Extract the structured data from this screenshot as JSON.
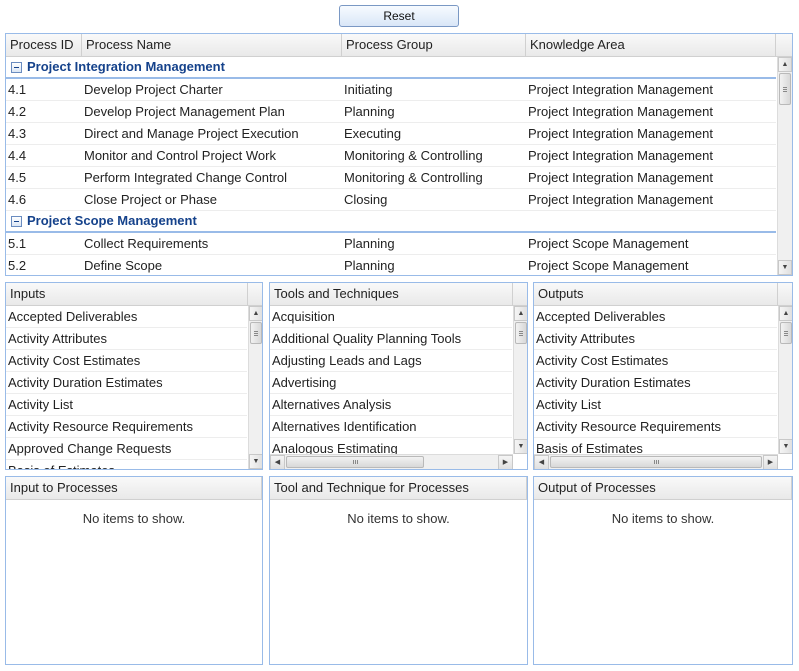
{
  "toolbar": {
    "reset_label": "Reset"
  },
  "processes": {
    "columns": [
      "Process ID",
      "Process Name",
      "Process Group",
      "Knowledge Area"
    ],
    "groups": [
      {
        "label": "Project Integration Management",
        "rows": [
          [
            "4.1",
            "Develop Project Charter",
            "Initiating",
            "Project Integration Management"
          ],
          [
            "4.2",
            "Develop Project Management Plan",
            "Planning",
            "Project Integration Management"
          ],
          [
            "4.3",
            "Direct and Manage Project Execution",
            "Executing",
            "Project Integration Management"
          ],
          [
            "4.4",
            "Monitor and Control Project Work",
            "Monitoring & Controlling",
            "Project Integration Management"
          ],
          [
            "4.5",
            "Perform Integrated Change Control",
            "Monitoring & Controlling",
            "Project Integration Management"
          ],
          [
            "4.6",
            "Close Project or Phase",
            "Closing",
            "Project Integration Management"
          ]
        ]
      },
      {
        "label": "Project Scope Management",
        "rows": [
          [
            "5.1",
            "Collect Requirements",
            "Planning",
            "Project Scope Management"
          ],
          [
            "5.2",
            "Define Scope",
            "Planning",
            "Project Scope Management"
          ]
        ]
      }
    ]
  },
  "inputs": {
    "header": "Inputs",
    "items": [
      "Accepted Deliverables",
      "Activity Attributes",
      "Activity Cost Estimates",
      "Activity Duration Estimates",
      "Activity List",
      "Activity Resource Requirements",
      "Approved Change Requests",
      "Basis of Estimates"
    ]
  },
  "tools": {
    "header": "Tools and Techniques",
    "items": [
      "Acquisition",
      "Additional Quality Planning Tools",
      "Adjusting Leads and Lags",
      "Advertising",
      "Alternatives Analysis",
      "Alternatives Identification",
      "Analogous Estimating"
    ]
  },
  "outputs": {
    "header": "Outputs",
    "items": [
      "Accepted Deliverables",
      "Activity Attributes",
      "Activity Cost Estimates",
      "Activity Duration Estimates",
      "Activity List",
      "Activity Resource Requirements",
      "Basis of Estimates"
    ]
  },
  "input_to_processes": {
    "header": "Input to Processes",
    "empty_text": "No items to show."
  },
  "tool_for_processes": {
    "header": "Tool and Technique for Processes",
    "empty_text": "No items to show."
  },
  "output_of_processes": {
    "header": "Output of Processes",
    "empty_text": "No items to show."
  },
  "scrollbar": {
    "up_glyph": "▲",
    "down_glyph": "▼",
    "left_glyph": "◀",
    "right_glyph": "▶"
  },
  "colors": {
    "group_text": "#15428b",
    "panel_border": "#99bbe8"
  }
}
